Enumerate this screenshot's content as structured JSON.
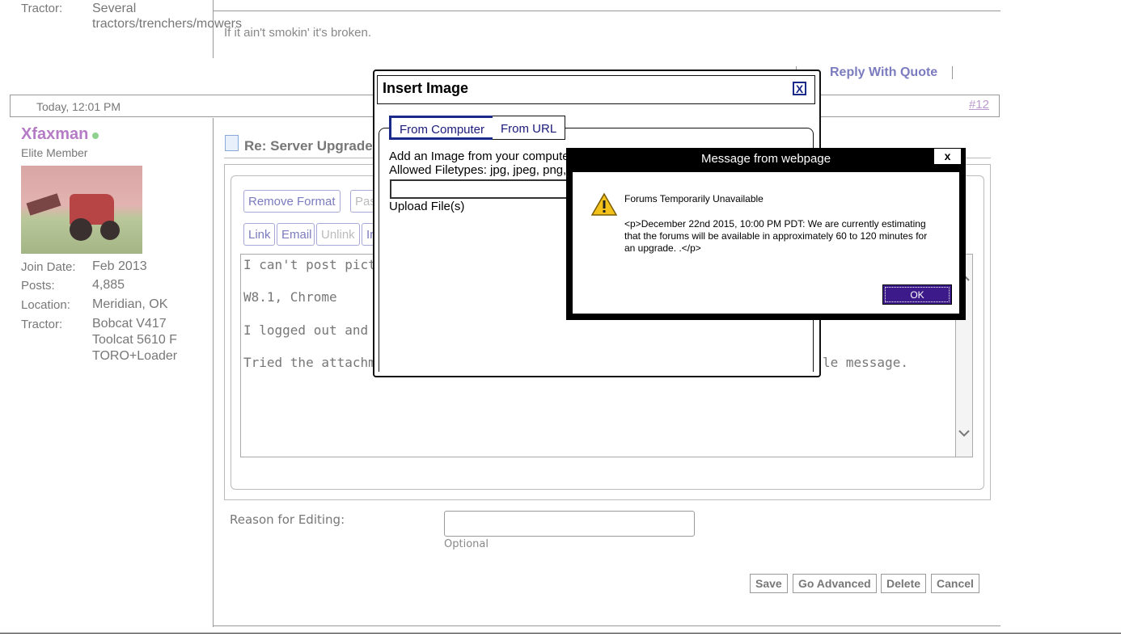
{
  "prev_post": {
    "tractor_label": "Tractor:",
    "tractor_value_1": "Several",
    "tractor_value_2": "tractors/trenchers/mowers",
    "signature": "If it ain't smokin' it's broken.",
    "reply_with_quote": "Reply With Quote"
  },
  "post": {
    "date": "Today, 12:01 PM",
    "number": "#12",
    "username": "Xfaxman",
    "rank": "Elite Member",
    "join_label": "Join Date:",
    "join_value": "Feb 2013",
    "posts_label": "Posts:",
    "posts_value": "4,885",
    "location_label": "Location:",
    "location_value": "Meridian, OK",
    "tractor_label": "Tractor:",
    "tractor_value_1": "Bobcat V417",
    "tractor_value_2": "Toolcat 5610 F",
    "tractor_value_3": "TORO+Loader",
    "title": "Re: Server Upgrade"
  },
  "editor": {
    "toolbar_row1": [
      "Remove Format",
      "Pas"
    ],
    "toolbar_row2": [
      "Link",
      "Email",
      "Unlink",
      "Ir"
    ],
    "lines": [
      "I can't post pictures",
      "W8.1, Chrome",
      "I logged out and ba",
      "Tried the attachme"
    ],
    "line4_tail": "le message.",
    "reason_label": "Reason for Editing:",
    "reason_hint": "Optional",
    "buttons": [
      "Save",
      "Go Advanced",
      "Delete",
      "Cancel"
    ]
  },
  "insert_image": {
    "title": "Insert Image",
    "close": "X",
    "tab_computer": "From Computer",
    "tab_url": "From URL",
    "line1": "Add an Image from your compute",
    "line2": "Allowed Filetypes: jpg, jpeg, png,",
    "upload": "Upload File(s)"
  },
  "message_box": {
    "title": "Message from webpage",
    "close": "x",
    "heading": "Forums Temporarily Unavailable",
    "text": "<p>December 22nd 2015, 10:00 PM PDT: We are currently estimating that the forums will be available in approximately 60 to 120 minutes for an upgrade. .</p>",
    "ok": "OK",
    "icon": "warning-icon"
  }
}
